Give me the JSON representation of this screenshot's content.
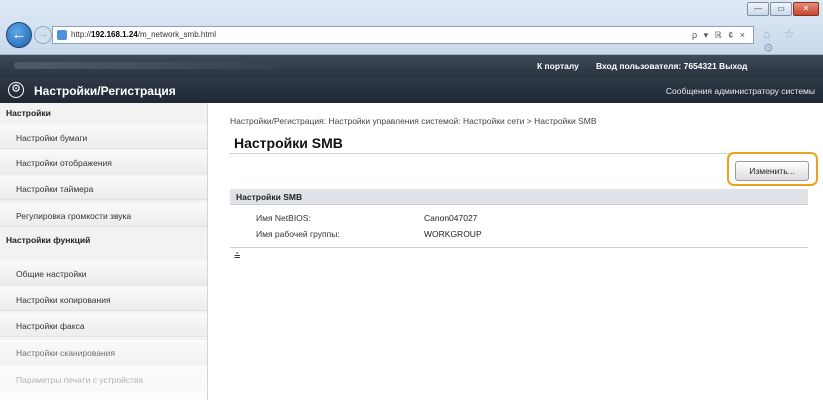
{
  "browser": {
    "url_prefix": "http://",
    "url_host": "192.168.1.24",
    "url_path": "/m_network_smb.html",
    "address_tools": "ρ ▾ ℝ ¢ ×",
    "window_buttons": [
      "—",
      "▭",
      "✕"
    ],
    "back_glyph": "←",
    "forward_glyph": "→",
    "nav_icons": "⌂ ☆ ⚙"
  },
  "topbar": {
    "portal_link": "К порталу",
    "login_text": "Вход пользователя: 7654321 Выход"
  },
  "header": {
    "logo_glyph": "⚙",
    "title": "Настройки/Регистрация",
    "admin_message": "Сообщения администратору системы"
  },
  "sidebar": {
    "section_settings": "Настройки",
    "section_functions": "Настройки функций",
    "items_settings": [
      {
        "label": "Настройки бумаги"
      },
      {
        "label": "Настройки отображения"
      },
      {
        "label": "Настройки таймера"
      },
      {
        "label": "Регулировка громкости звука"
      }
    ],
    "items_functions": [
      {
        "label": "Общие настройки"
      },
      {
        "label": "Настройки копирования"
      },
      {
        "label": "Настройки факса"
      },
      {
        "label": "Настройки сканирования"
      },
      {
        "label": "Параметры печати с устройства"
      }
    ]
  },
  "main": {
    "breadcrumb": "Настройки/Регистрация: Настройки управления системой: Настройки сети > Настройки SMB",
    "page_title": "Настройки SMB",
    "edit_button": "Изменить...",
    "section_title": "Настройки SMB",
    "fields": [
      {
        "label": "Имя NetBIOS:",
        "value": "Canon047027"
      },
      {
        "label": "Имя рабочей группы:",
        "value": "WORKGROUP"
      }
    ],
    "to_top_glyph": "⩮"
  },
  "colors": {
    "highlight": "#f0a020",
    "header_dark": "#2a3440"
  }
}
